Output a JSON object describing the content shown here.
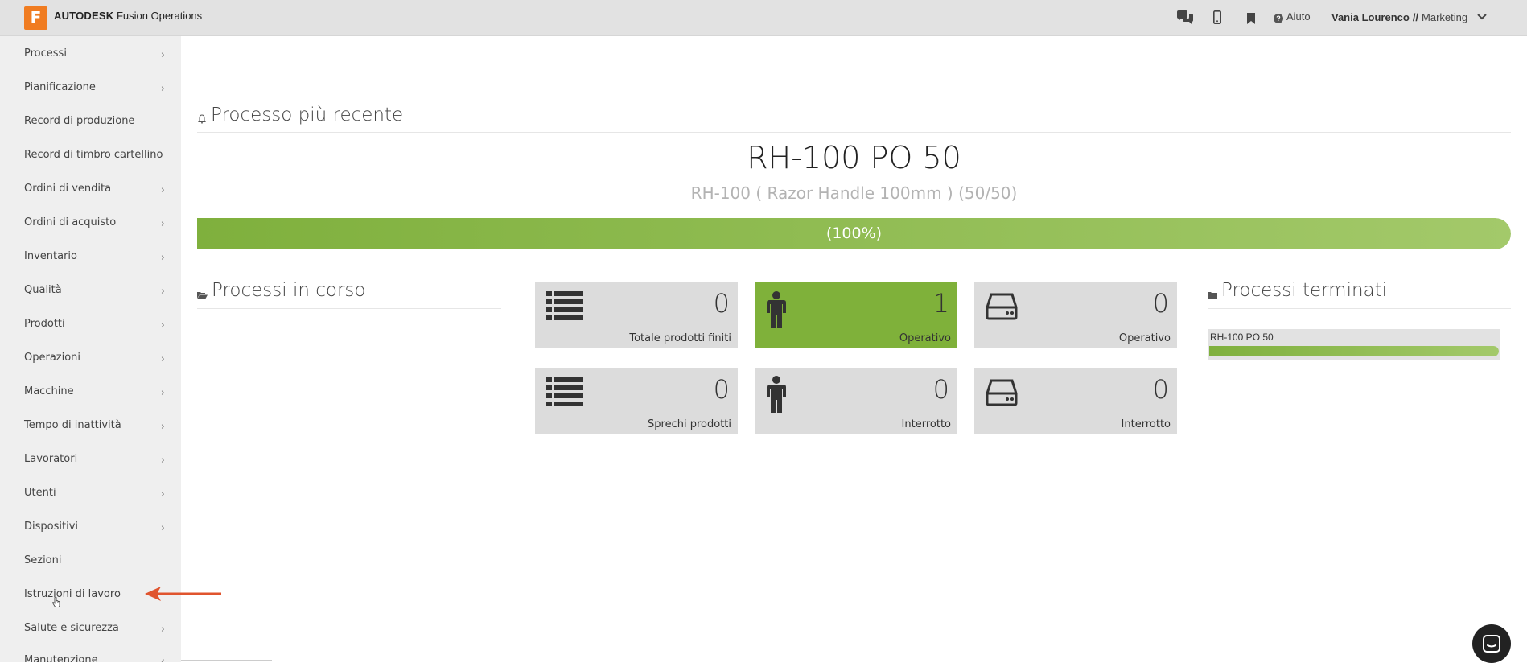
{
  "app": {
    "logo_letter": "F",
    "brand": "AUTODESK",
    "product": "Fusion Operations"
  },
  "header": {
    "icons": [
      "chat-icon",
      "mobile-icon",
      "bookmark-icon"
    ],
    "help_label": "Aiuto",
    "user_name": "Vania Lourenco",
    "separator": "//",
    "user_role": "Marketing"
  },
  "sidebar": {
    "items": [
      {
        "label": "Processi",
        "chevron": "›"
      },
      {
        "label": "Pianificazione",
        "chevron": "›"
      },
      {
        "label": "Record di produzione",
        "chevron": ""
      },
      {
        "label": "Record di timbro cartellino",
        "chevron": ""
      },
      {
        "label": "Ordini di vendita",
        "chevron": "›"
      },
      {
        "label": "Ordini di acquisto",
        "chevron": "›"
      },
      {
        "label": "Inventario",
        "chevron": "›"
      },
      {
        "label": "Qualità",
        "chevron": "›"
      },
      {
        "label": "Prodotti",
        "chevron": "›"
      },
      {
        "label": "Operazioni",
        "chevron": "›"
      },
      {
        "label": "Macchine",
        "chevron": "›"
      },
      {
        "label": "Tempo di inattività",
        "chevron": "›"
      },
      {
        "label": "Lavoratori",
        "chevron": "›"
      },
      {
        "label": "Utenti",
        "chevron": "›"
      },
      {
        "label": "Dispositivi",
        "chevron": "›"
      },
      {
        "label": "Sezioni",
        "chevron": ""
      },
      {
        "label": "Istruzioni di lavoro",
        "chevron": ""
      },
      {
        "label": "Salute e sicurezza",
        "chevron": "›"
      },
      {
        "label": "Manutenzione",
        "chevron": "‹"
      }
    ]
  },
  "recent": {
    "title": "Processo più recente",
    "code": "RH-100 PO 50",
    "subtitle": "RH-100 ( Razor Handle 100mm ) (50/50)",
    "progress_fraction": 1.0,
    "progress_label": "(100%)"
  },
  "in_progress": {
    "title": "Processi in corso"
  },
  "tiles": [
    {
      "value": "0",
      "label": "Totale prodotti finiti",
      "icon": "list-icon",
      "highlight": false
    },
    {
      "value": "1",
      "label": "Operativo",
      "icon": "worker-icon",
      "highlight": true
    },
    {
      "value": "0",
      "label": "Operativo",
      "icon": "machine-icon",
      "highlight": false
    },
    {
      "value": "0",
      "label": "Sprechi prodotti",
      "icon": "list-icon",
      "highlight": false
    },
    {
      "value": "0",
      "label": "Interrotto",
      "icon": "worker-icon",
      "highlight": false
    },
    {
      "value": "0",
      "label": "Interrotto",
      "icon": "machine-icon",
      "highlight": false
    }
  ],
  "completed": {
    "title": "Processi terminati",
    "items": [
      {
        "name": "RH-100 PO 50",
        "progress_fraction": 1.0
      }
    ]
  },
  "colors": {
    "accent_green": "#7fb13a",
    "logo_orange": "#f07c21",
    "annotation_arrow": "#e0542e"
  }
}
